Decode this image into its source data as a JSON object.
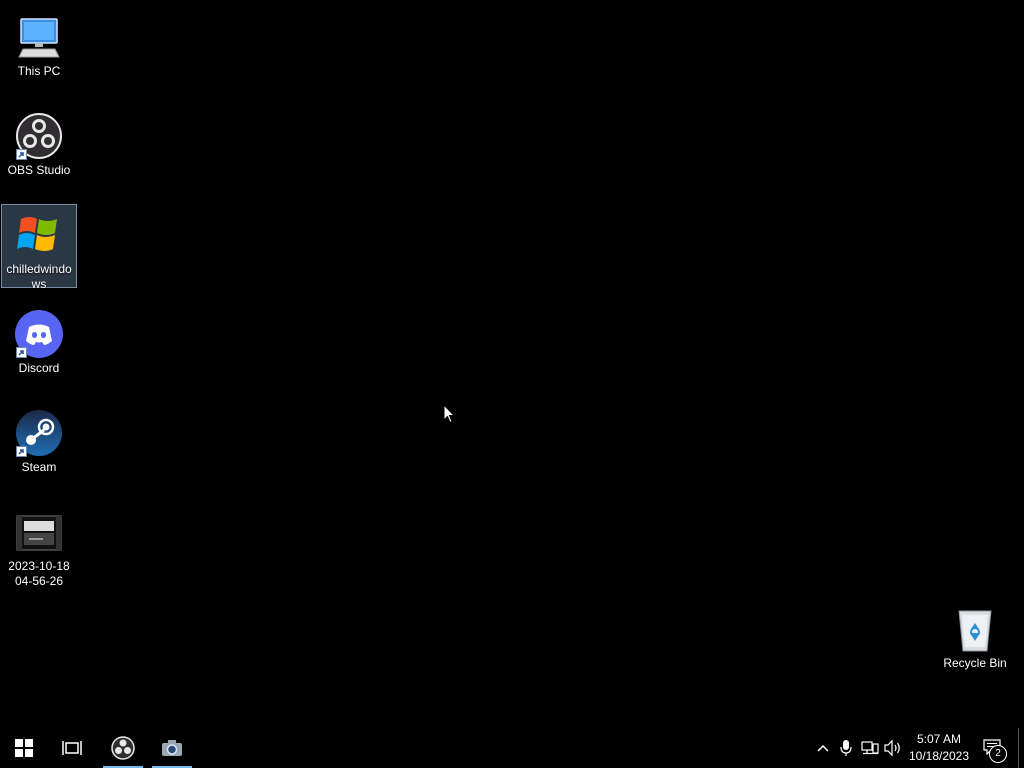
{
  "desktop": {
    "icons": [
      {
        "label": "This PC",
        "icon": "computer-icon",
        "shortcut": false,
        "selected": false
      },
      {
        "label": "OBS Studio",
        "icon": "obs-icon",
        "shortcut": true,
        "selected": false
      },
      {
        "label": "chilledwindows",
        "icon": "windows-xp-logo-icon",
        "shortcut": false,
        "selected": true
      },
      {
        "label": "Discord",
        "icon": "discord-icon",
        "shortcut": true,
        "selected": false
      },
      {
        "label": "Steam",
        "icon": "steam-icon",
        "shortcut": true,
        "selected": false
      },
      {
        "label": "2023-10-18 04-56-26",
        "icon": "video-file-icon",
        "shortcut": false,
        "selected": false
      }
    ],
    "recycle_bin": {
      "label": "Recycle Bin",
      "icon": "recycle-bin-icon"
    }
  },
  "taskbar": {
    "buttons": [
      {
        "name": "start",
        "icon": "windows-start-icon"
      },
      {
        "name": "task-view",
        "icon": "task-view-icon"
      },
      {
        "name": "obs",
        "icon": "obs-icon",
        "active": true
      },
      {
        "name": "camera",
        "icon": "camera-icon",
        "active": true
      }
    ],
    "tray": {
      "icons": [
        "chevron-up-icon",
        "microphone-icon",
        "network-icon",
        "volume-icon"
      ],
      "time": "5:07 AM",
      "date": "10/18/2023",
      "notification_count": "2"
    }
  },
  "colors": {
    "background": "#000000",
    "active_indicator": "#76b9ed",
    "discord": "#5865f2"
  }
}
